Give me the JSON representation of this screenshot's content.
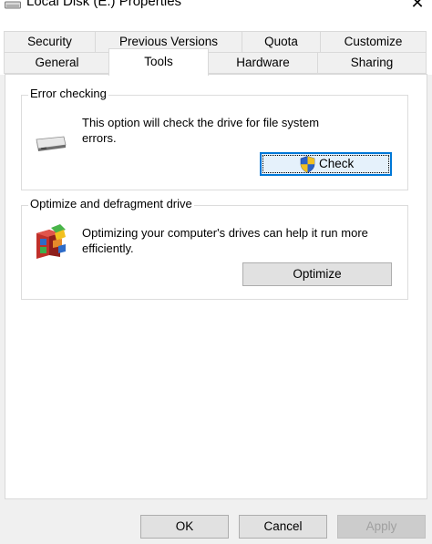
{
  "window": {
    "title": "Local Disk (E:) Properties"
  },
  "tabs": {
    "row1": [
      "Security",
      "Previous Versions",
      "Quota",
      "Customize"
    ],
    "row2": [
      "General",
      "Tools",
      "Hardware",
      "Sharing"
    ],
    "active": "Tools"
  },
  "error_checking": {
    "label": "Error checking",
    "description": "This option will check the drive for file system errors.",
    "button": "Check"
  },
  "optimize": {
    "label": "Optimize and defragment drive",
    "description": "Optimizing your computer's drives can help it run more efficiently.",
    "button": "Optimize"
  },
  "footer": {
    "ok": "OK",
    "cancel": "Cancel",
    "apply": "Apply"
  },
  "colors": {
    "focus_border": "#0078d7",
    "button_face": "#e1e1e1",
    "disabled_text": "#a0a0a0"
  }
}
